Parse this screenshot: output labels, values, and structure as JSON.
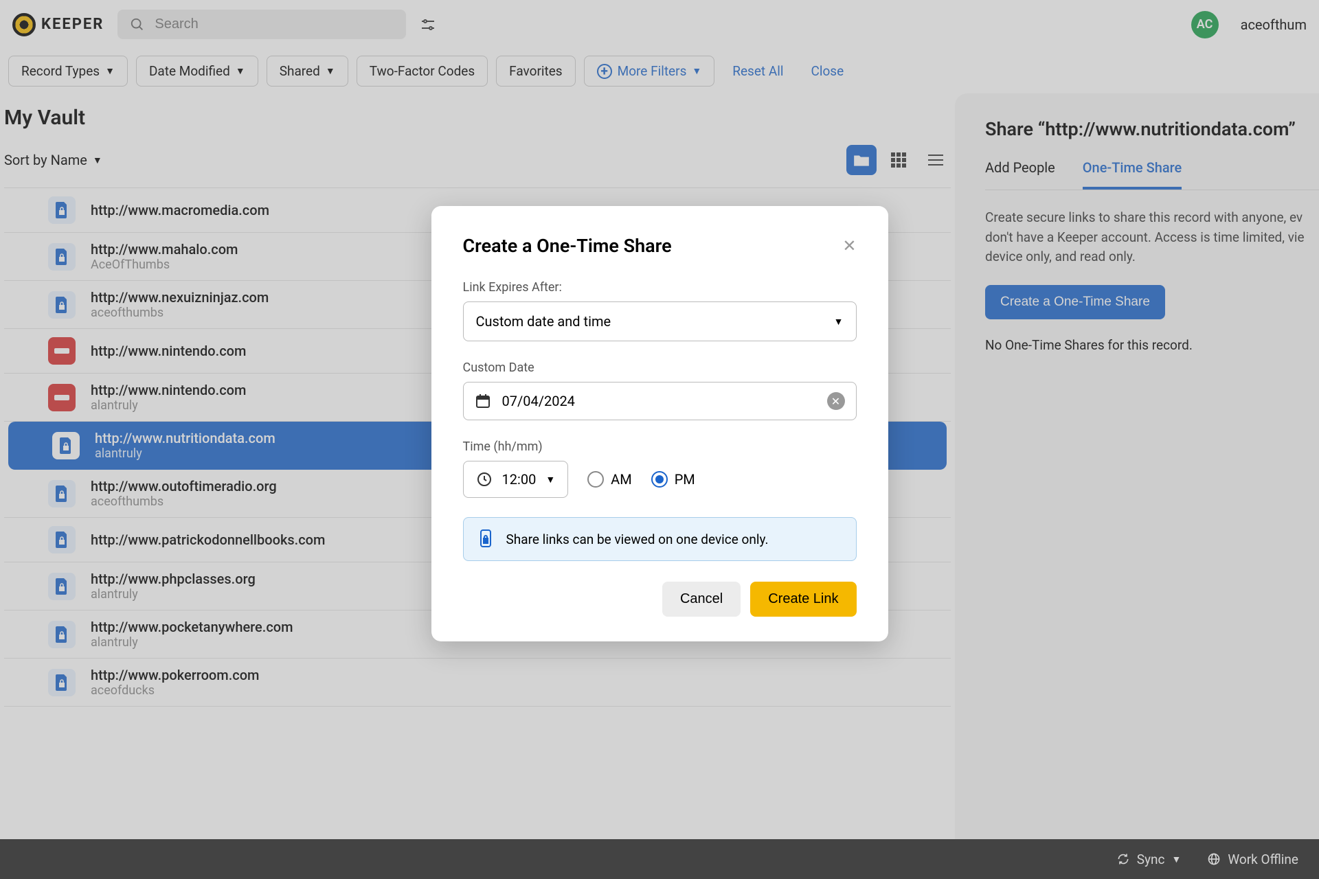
{
  "brand": "KEEPER",
  "search": {
    "placeholder": "Search"
  },
  "user": {
    "initials": "AC",
    "name": "aceofthum"
  },
  "filters": {
    "record_types": "Record Types",
    "date_modified": "Date Modified",
    "shared": "Shared",
    "two_factor": "Two-Factor Codes",
    "favorites": "Favorites",
    "more": "More Filters",
    "reset": "Reset All",
    "close": "Close"
  },
  "vault": {
    "title": "My Vault",
    "sort_label": "Sort by Name",
    "records": [
      {
        "title": "http://www.macromedia.com",
        "sub": "",
        "icon": "blue"
      },
      {
        "title": "http://www.mahalo.com",
        "sub": "AceOfThumbs",
        "icon": "blue"
      },
      {
        "title": "http://www.nexuizninjaz.com",
        "sub": "aceofthumbs",
        "icon": "blue"
      },
      {
        "title": "http://www.nintendo.com",
        "sub": "",
        "icon": "red"
      },
      {
        "title": "http://www.nintendo.com",
        "sub": "alantruly",
        "icon": "red"
      },
      {
        "title": "http://www.nutritiondata.com",
        "sub": "alantruly",
        "icon": "blue",
        "selected": true
      },
      {
        "title": "http://www.outoftimeradio.org",
        "sub": "aceofthumbs",
        "icon": "blue"
      },
      {
        "title": "http://www.patrickodonnellbooks.com",
        "sub": "",
        "icon": "blue"
      },
      {
        "title": "http://www.phpclasses.org",
        "sub": "alantruly",
        "icon": "blue"
      },
      {
        "title": "http://www.pocketanywhere.com",
        "sub": "alantruly",
        "icon": "blue"
      },
      {
        "title": "http://www.pokerroom.com",
        "sub": "aceofducks",
        "icon": "blue"
      }
    ]
  },
  "side": {
    "title": "Share “http://www.nutritiondata.com”",
    "tab_add": "Add People",
    "tab_ots": "One-Time Share",
    "desc": "Create secure links to share this record with anyone, ev don't have a Keeper account. Access is time limited, vie device only, and read only.",
    "create_btn": "Create a One-Time Share",
    "empty": "No One-Time Shares for this record."
  },
  "modal": {
    "title": "Create a One-Time Share",
    "expires_label": "Link Expires After:",
    "expires_value": "Custom date and time",
    "date_label": "Custom Date",
    "date_value": "07/04/2024",
    "time_label": "Time (hh/mm)",
    "time_value": "12:00",
    "am": "AM",
    "pm": "PM",
    "info": "Share links can be viewed on one device only.",
    "cancel": "Cancel",
    "create": "Create Link"
  },
  "status": {
    "sync": "Sync",
    "offline": "Work Offline"
  }
}
